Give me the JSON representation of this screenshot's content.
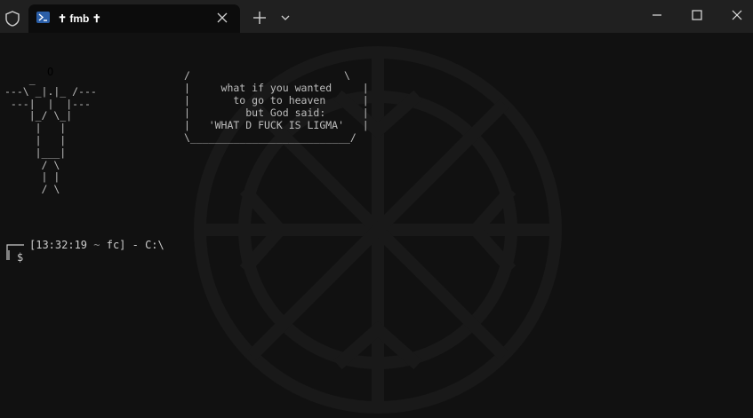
{
  "window": {
    "tab_title": "✝ fmb ✝",
    "icons": [
      "shield-icon",
      "powershell-icon",
      "close-icon",
      "plus-icon",
      "chevron-down-icon",
      "minimize-icon",
      "maximize-icon",
      "close-icon"
    ]
  },
  "terminal": {
    "halo": "O",
    "figure": "    _\n---\\ _|.|_ /---\n ---|  |  |---\n    |_/ \\_|\n     |   |\n     |   |\n     |___|\n      / \\\n      | |\n      / \\",
    "bubble": "/                         \\\n|     what if you wanted     |\n|       to go to heaven      |\n|         but God said:      |\n|   'WHAT D FUCK IS LIGMA'   |\n\\__________________________/",
    "prompt": {
      "time": "[13:32:19",
      "tilde": "~",
      "rest": "fc] - C:\\",
      "dollar": "$"
    }
  },
  "colors": {
    "titlebar": "#202020",
    "terminal_bg": "#111111",
    "text": "#cccccc",
    "halo": "#e6d27a"
  }
}
